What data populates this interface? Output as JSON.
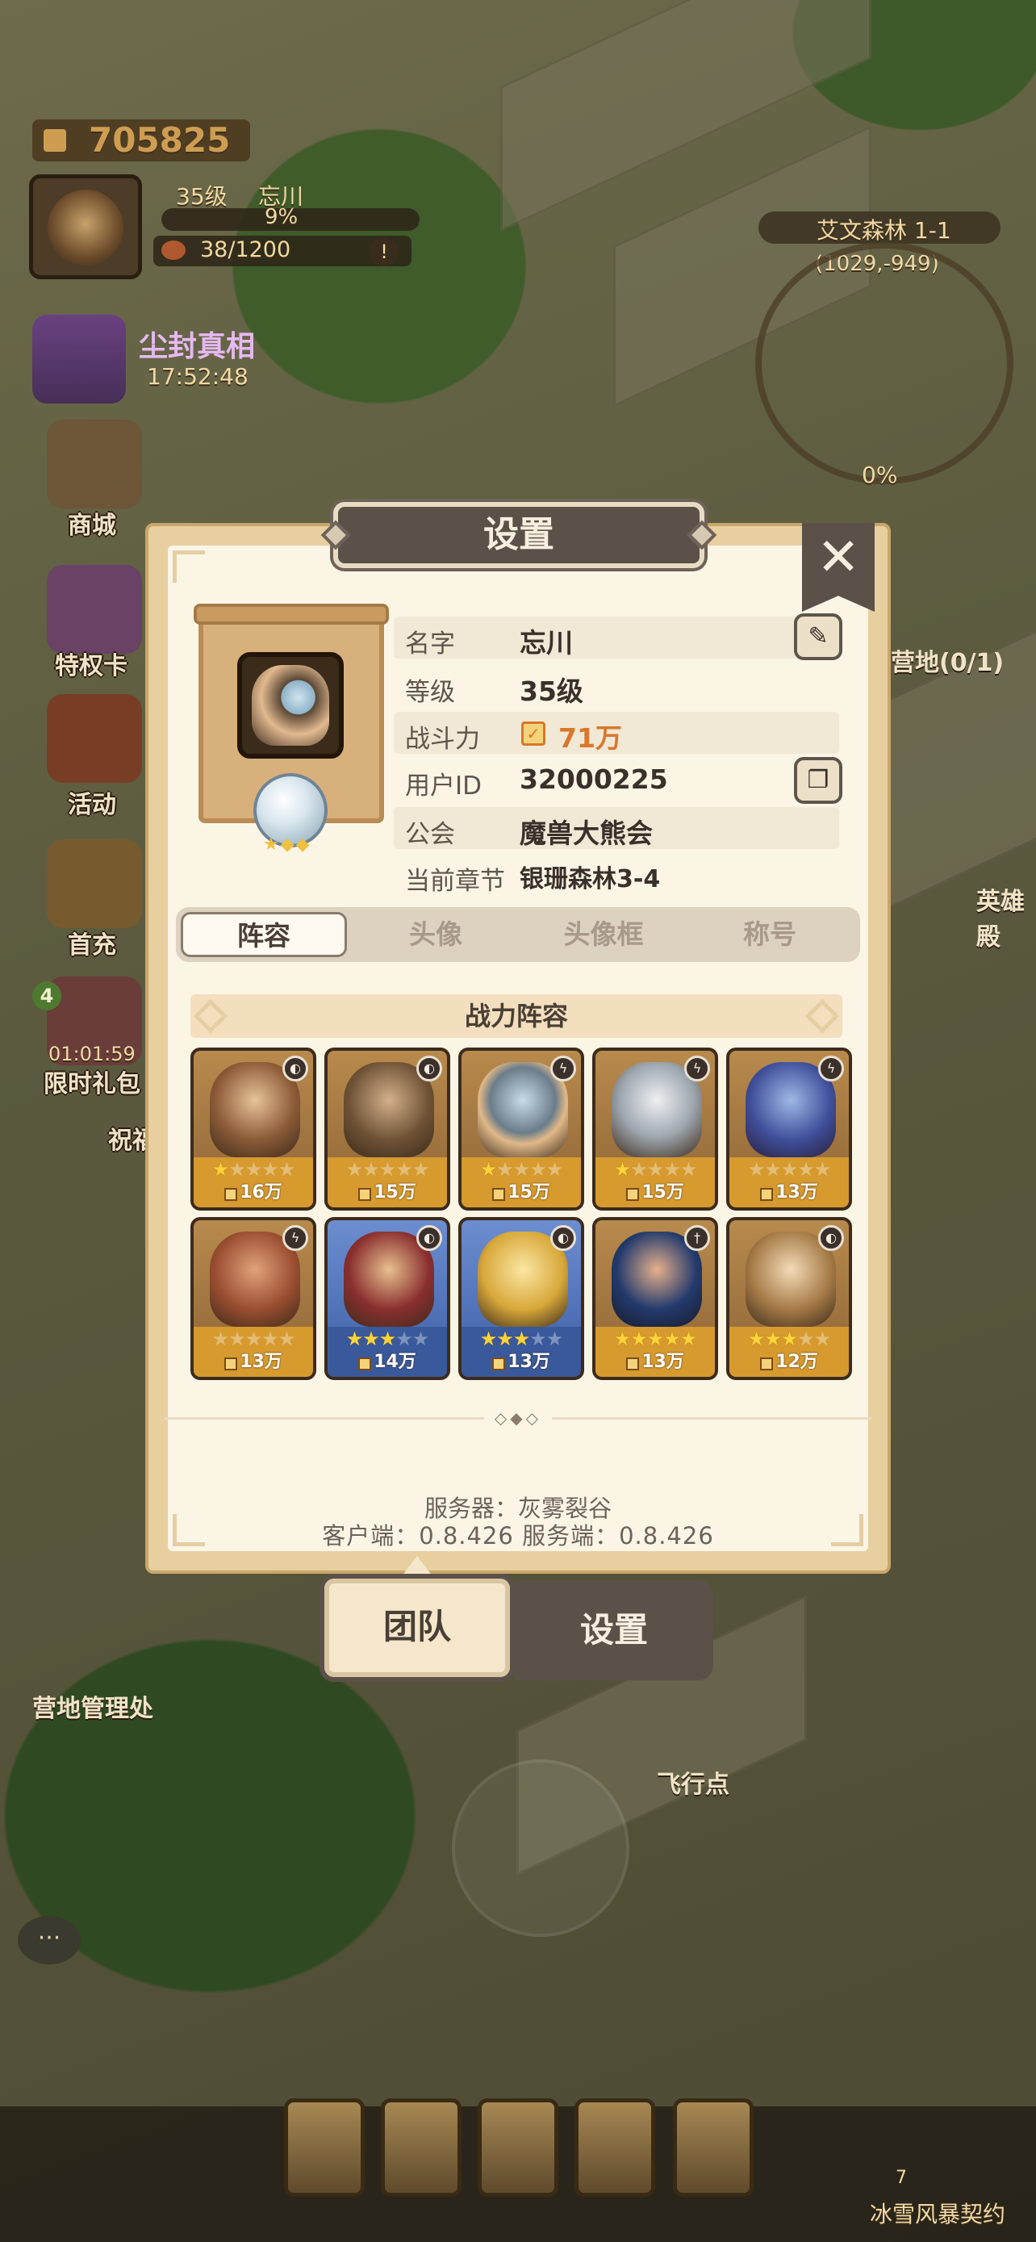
{
  "hud": {
    "total_power": "705825",
    "player_level": "35级",
    "player_name": "忘川",
    "exp_percent": "9%",
    "food": "38/1200",
    "event_name": "尘封真相",
    "event_timer": "17:52:48",
    "side_menu": [
      "商城",
      "特权卡",
      "活动",
      "首充",
      "限时礼包",
      "祝福"
    ],
    "side_badge": "4",
    "side_timer": "01:01:59",
    "zone_name": "艾文森林 1-1",
    "zone_coords": "(1029,-949)",
    "minimap_percent": "0%",
    "camp_label": "营地(0/1)",
    "hero_label": "英雄殿",
    "camp_manager": "营地管理处",
    "flight_point": "飞行点",
    "bottom_label": "冰雪风暴契约",
    "bottom_number": "7",
    "chat_icon": "chat-bubble"
  },
  "dialog": {
    "title": "设置",
    "close_label": "✕",
    "profile": {
      "rows": [
        {
          "label": "名字",
          "value": "忘川"
        },
        {
          "label": "等级",
          "value": "35级"
        },
        {
          "label": "战斗力",
          "value": "71万"
        },
        {
          "label": "用户ID",
          "value": "32000225"
        },
        {
          "label": "公会",
          "value": "魔兽大熊会"
        },
        {
          "label": "当前章节",
          "value": "银珊森林3-4"
        }
      ],
      "edit_icon": "edit-icon",
      "copy_icon": "copy-icon"
    },
    "tabs": [
      "阵容",
      "头像",
      "头像框",
      "称号"
    ],
    "active_tab": "阵容",
    "section_title": "战力阵容",
    "heroes": [
      {
        "power": "16万",
        "stars": 1,
        "frame": "gold",
        "class": "shield"
      },
      {
        "power": "15万",
        "stars": 0,
        "frame": "gold",
        "class": "shield"
      },
      {
        "power": "15万",
        "stars": 1,
        "frame": "gold",
        "class": "wing"
      },
      {
        "power": "15万",
        "stars": 1,
        "frame": "gold",
        "class": "wing"
      },
      {
        "power": "13万",
        "stars": 0,
        "frame": "gold",
        "class": "wing"
      },
      {
        "power": "13万",
        "stars": 0,
        "frame": "gold",
        "class": "wing"
      },
      {
        "power": "14万",
        "stars": 3,
        "frame": "blue",
        "class": "shield"
      },
      {
        "power": "13万",
        "stars": 3,
        "frame": "blue",
        "class": "shield"
      },
      {
        "power": "13万",
        "stars": 5,
        "frame": "gold",
        "class": "sword"
      },
      {
        "power": "12万",
        "stars": 3,
        "frame": "gold",
        "class": "shield"
      }
    ],
    "server_line": "服务器：灰雾裂谷",
    "version_line": "客户端：0.8.426 服务端：0.8.426"
  },
  "bottom_tabs": {
    "team": "团队",
    "settings": "设置"
  }
}
